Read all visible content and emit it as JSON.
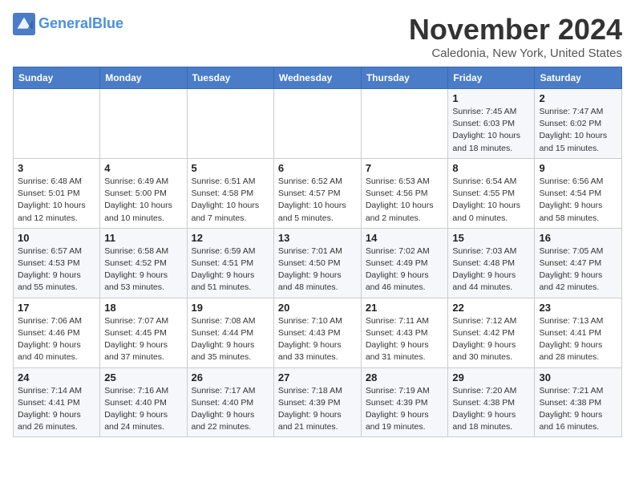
{
  "logo": {
    "line1": "General",
    "line2": "Blue"
  },
  "title": "November 2024",
  "subtitle": "Caledonia, New York, United States",
  "weekdays": [
    "Sunday",
    "Monday",
    "Tuesday",
    "Wednesday",
    "Thursday",
    "Friday",
    "Saturday"
  ],
  "weeks": [
    [
      {
        "day": "",
        "info": ""
      },
      {
        "day": "",
        "info": ""
      },
      {
        "day": "",
        "info": ""
      },
      {
        "day": "",
        "info": ""
      },
      {
        "day": "",
        "info": ""
      },
      {
        "day": "1",
        "info": "Sunrise: 7:45 AM\nSunset: 6:03 PM\nDaylight: 10 hours and 18 minutes."
      },
      {
        "day": "2",
        "info": "Sunrise: 7:47 AM\nSunset: 6:02 PM\nDaylight: 10 hours and 15 minutes."
      }
    ],
    [
      {
        "day": "3",
        "info": "Sunrise: 6:48 AM\nSunset: 5:01 PM\nDaylight: 10 hours and 12 minutes."
      },
      {
        "day": "4",
        "info": "Sunrise: 6:49 AM\nSunset: 5:00 PM\nDaylight: 10 hours and 10 minutes."
      },
      {
        "day": "5",
        "info": "Sunrise: 6:51 AM\nSunset: 4:58 PM\nDaylight: 10 hours and 7 minutes."
      },
      {
        "day": "6",
        "info": "Sunrise: 6:52 AM\nSunset: 4:57 PM\nDaylight: 10 hours and 5 minutes."
      },
      {
        "day": "7",
        "info": "Sunrise: 6:53 AM\nSunset: 4:56 PM\nDaylight: 10 hours and 2 minutes."
      },
      {
        "day": "8",
        "info": "Sunrise: 6:54 AM\nSunset: 4:55 PM\nDaylight: 10 hours and 0 minutes."
      },
      {
        "day": "9",
        "info": "Sunrise: 6:56 AM\nSunset: 4:54 PM\nDaylight: 9 hours and 58 minutes."
      }
    ],
    [
      {
        "day": "10",
        "info": "Sunrise: 6:57 AM\nSunset: 4:53 PM\nDaylight: 9 hours and 55 minutes."
      },
      {
        "day": "11",
        "info": "Sunrise: 6:58 AM\nSunset: 4:52 PM\nDaylight: 9 hours and 53 minutes."
      },
      {
        "day": "12",
        "info": "Sunrise: 6:59 AM\nSunset: 4:51 PM\nDaylight: 9 hours and 51 minutes."
      },
      {
        "day": "13",
        "info": "Sunrise: 7:01 AM\nSunset: 4:50 PM\nDaylight: 9 hours and 48 minutes."
      },
      {
        "day": "14",
        "info": "Sunrise: 7:02 AM\nSunset: 4:49 PM\nDaylight: 9 hours and 46 minutes."
      },
      {
        "day": "15",
        "info": "Sunrise: 7:03 AM\nSunset: 4:48 PM\nDaylight: 9 hours and 44 minutes."
      },
      {
        "day": "16",
        "info": "Sunrise: 7:05 AM\nSunset: 4:47 PM\nDaylight: 9 hours and 42 minutes."
      }
    ],
    [
      {
        "day": "17",
        "info": "Sunrise: 7:06 AM\nSunset: 4:46 PM\nDaylight: 9 hours and 40 minutes."
      },
      {
        "day": "18",
        "info": "Sunrise: 7:07 AM\nSunset: 4:45 PM\nDaylight: 9 hours and 37 minutes."
      },
      {
        "day": "19",
        "info": "Sunrise: 7:08 AM\nSunset: 4:44 PM\nDaylight: 9 hours and 35 minutes."
      },
      {
        "day": "20",
        "info": "Sunrise: 7:10 AM\nSunset: 4:43 PM\nDaylight: 9 hours and 33 minutes."
      },
      {
        "day": "21",
        "info": "Sunrise: 7:11 AM\nSunset: 4:43 PM\nDaylight: 9 hours and 31 minutes."
      },
      {
        "day": "22",
        "info": "Sunrise: 7:12 AM\nSunset: 4:42 PM\nDaylight: 9 hours and 30 minutes."
      },
      {
        "day": "23",
        "info": "Sunrise: 7:13 AM\nSunset: 4:41 PM\nDaylight: 9 hours and 28 minutes."
      }
    ],
    [
      {
        "day": "24",
        "info": "Sunrise: 7:14 AM\nSunset: 4:41 PM\nDaylight: 9 hours and 26 minutes."
      },
      {
        "day": "25",
        "info": "Sunrise: 7:16 AM\nSunset: 4:40 PM\nDaylight: 9 hours and 24 minutes."
      },
      {
        "day": "26",
        "info": "Sunrise: 7:17 AM\nSunset: 4:40 PM\nDaylight: 9 hours and 22 minutes."
      },
      {
        "day": "27",
        "info": "Sunrise: 7:18 AM\nSunset: 4:39 PM\nDaylight: 9 hours and 21 minutes."
      },
      {
        "day": "28",
        "info": "Sunrise: 7:19 AM\nSunset: 4:39 PM\nDaylight: 9 hours and 19 minutes."
      },
      {
        "day": "29",
        "info": "Sunrise: 7:20 AM\nSunset: 4:38 PM\nDaylight: 9 hours and 18 minutes."
      },
      {
        "day": "30",
        "info": "Sunrise: 7:21 AM\nSunset: 4:38 PM\nDaylight: 9 hours and 16 minutes."
      }
    ]
  ]
}
